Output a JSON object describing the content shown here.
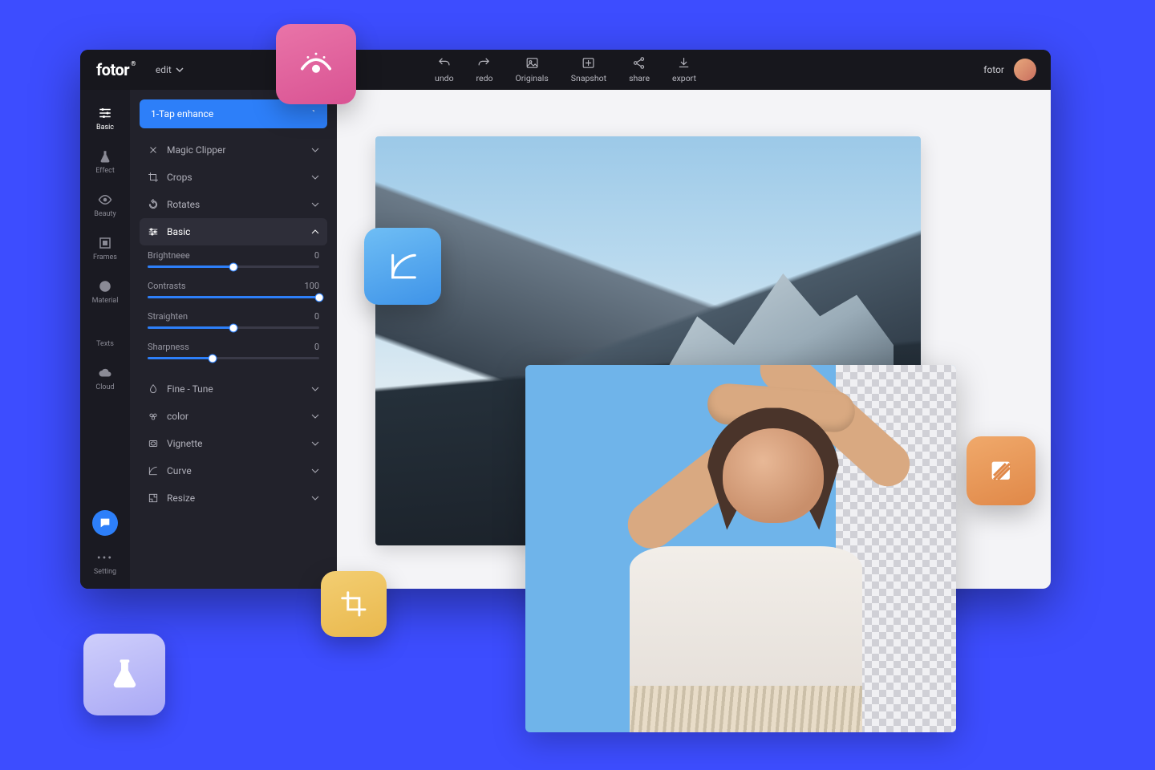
{
  "app": {
    "logo": "fotor",
    "edit_label": "edit"
  },
  "topbar": {
    "undo": "undo",
    "redo": "redo",
    "originals": "Originals",
    "snapshot": "Snapshot",
    "share": "share",
    "export": "export"
  },
  "user": {
    "name": "fotor"
  },
  "rail": {
    "basic": "Basic",
    "effect": "Effect",
    "beauty": "Beauty",
    "frames": "Frames",
    "material": "Material",
    "texts": "Texts",
    "cloud": "Cloud",
    "setting": "Setting"
  },
  "panel": {
    "enhance": "1-Tap enhance",
    "magic_clipper": "Magic Clipper",
    "crops": "Crops",
    "rotates": "Rotates",
    "basic": "Basic",
    "fine_tune": "Fine - Tune",
    "color": "color",
    "vignette": "Vignette",
    "curve": "Curve",
    "resize": "Resize"
  },
  "sliders": {
    "brightness": {
      "label": "Brightneee",
      "value": 0,
      "pct": 50
    },
    "contrast": {
      "label": "Contrasts",
      "value": 100,
      "pct": 100
    },
    "straighten": {
      "label": "Straighten",
      "value": 0,
      "pct": 50
    },
    "sharpness": {
      "label": "Sharpness",
      "value": 0,
      "pct": 38
    }
  },
  "colors": {
    "accent": "#2d7ff9",
    "bg_page": "#3d4dff",
    "bg_dark": "#1a1a22",
    "bg_panel": "#22222b"
  },
  "tiles": {
    "pink": "eye-icon",
    "blue": "curve-icon",
    "orange": "hatch-icon",
    "yellow": "crop-icon",
    "lavender": "flask-icon"
  }
}
